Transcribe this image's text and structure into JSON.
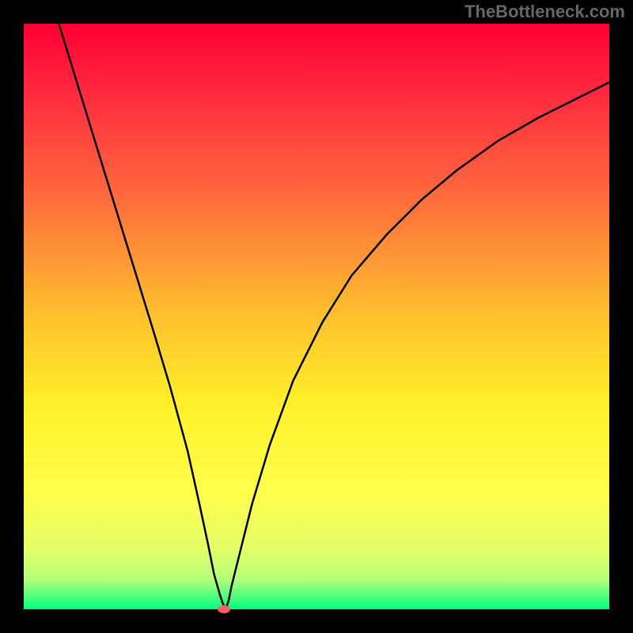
{
  "watermark": "TheBottleneck.com",
  "chart_data": {
    "type": "line",
    "title": "",
    "xlabel": "",
    "ylabel": "",
    "xlim": [
      0,
      100
    ],
    "ylim": [
      0,
      100
    ],
    "background": "rainbow-gradient",
    "gradient_stops": [
      {
        "pos": 0.0,
        "color": "#ff0033"
      },
      {
        "pos": 0.12,
        "color": "#ff2a3f"
      },
      {
        "pos": 0.3,
        "color": "#ff6d3d"
      },
      {
        "pos": 0.5,
        "color": "#ffc12d"
      },
      {
        "pos": 0.65,
        "color": "#fff02a"
      },
      {
        "pos": 0.8,
        "color": "#ffff4b"
      },
      {
        "pos": 0.9,
        "color": "#e3ff6a"
      },
      {
        "pos": 0.95,
        "color": "#b0ff7a"
      },
      {
        "pos": 1.0,
        "color": "#00ff7f"
      }
    ],
    "series": [
      {
        "name": "bottleneck-curve",
        "color": "#000000",
        "x": [
          6,
          10,
          14,
          18,
          22,
          25,
          28,
          30,
          31.5,
          32.5,
          33.5,
          34,
          34.5,
          35,
          35.5,
          37,
          39,
          42,
          46,
          51,
          56,
          62,
          68,
          74,
          81,
          88,
          95,
          100
        ],
        "values": [
          100,
          87,
          74,
          61,
          48,
          38,
          27,
          18,
          11,
          6,
          2.5,
          1,
          0,
          1.5,
          4,
          10,
          18,
          28,
          39,
          49,
          57,
          64,
          70,
          75,
          80,
          84,
          87.5,
          90
        ]
      }
    ],
    "marker": {
      "x": 34.2,
      "y": 0,
      "color": "#ff6060"
    }
  }
}
